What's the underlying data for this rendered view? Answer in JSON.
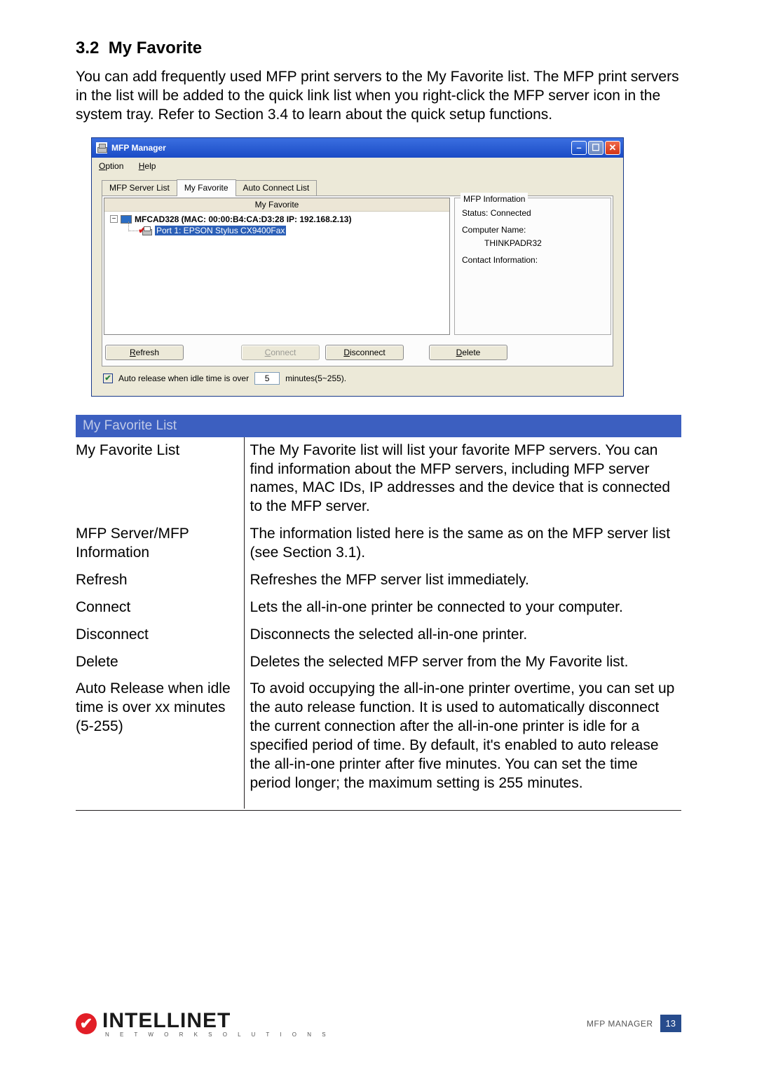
{
  "section": {
    "number": "3.2",
    "title": "My Favorite"
  },
  "intro": "You can add frequently used MFP print servers to the My Favorite list. The MFP print servers in the list will be added to the quick link list when you right-click the MFP server icon in the system tray. Refer to Section 3.4 to learn about the quick setup functions.",
  "mfp_window": {
    "title": "MFP Manager",
    "menu": {
      "option": "Option",
      "help": "Help"
    },
    "tabs": {
      "server_list": "MFP Server List",
      "favorite": "My Favorite",
      "auto_connect": "Auto Connect List"
    },
    "fav_header": "My Favorite",
    "tree": {
      "server_line": "MFCAD328 (MAC: 00:00:B4:CA:D3:28   IP: 192.168.2.13)",
      "port_line": "Port 1: EPSON Stylus CX9400Fax"
    },
    "info": {
      "legend": "MFP Information",
      "status": "Status: Connected",
      "cname_label": "Computer Name:",
      "cname_value": "THINKPADR32",
      "contact": "Contact Information:"
    },
    "buttons": {
      "refresh": "Refresh",
      "connect": "Connect",
      "disconnect": "Disconnect",
      "delete": "Delete"
    },
    "auto": {
      "checkbox_label_pre": "Auto release when idle time is over",
      "minutes_value": "5",
      "checkbox_label_post": "minutes(5~255)."
    }
  },
  "table": {
    "header": "My Favorite List",
    "rows": [
      {
        "c1": "My Favorite List",
        "c2": "The My Favorite list will list your favorite MFP servers. You can find information about the MFP servers, including MFP server names, MAC IDs, IP addresses and the device that is connected to the MFP server."
      },
      {
        "c1": "MFP Server/MFP Information",
        "c2": "The information listed here is the same as on the MFP server list (see Section 3.1)."
      },
      {
        "c1": "Refresh",
        "c2": "Refreshes the MFP server list immediately."
      },
      {
        "c1": "Connect",
        "c2": "Lets the all-in-one printer be connected to your computer."
      },
      {
        "c1": "Disconnect",
        "c2": "Disconnects the selected all-in-one printer."
      },
      {
        "c1": "Delete",
        "c2": "Deletes the selected MFP server from the My Favorite list."
      },
      {
        "c1": "Auto Release when idle time is over xx minutes (5-255)",
        "c2": "To avoid occupying the all-in-one printer overtime, you can set up the auto release function. It is used to automatically disconnect the current connection after the all-in-one printer is idle for a specified period of time. By default, it's enabled to auto release the all-in-one printer after five minutes. You can set the time period longer; the maximum setting is 255 minutes."
      }
    ]
  },
  "footer": {
    "brand": "INTELLINET",
    "sub": "N E T W O R K   S O L U T I O N S",
    "section_label": "MFP MANAGER",
    "page": "13"
  }
}
